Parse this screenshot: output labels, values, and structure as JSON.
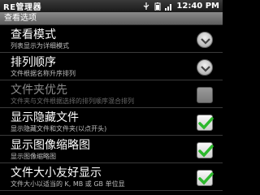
{
  "statusbar": {
    "app_name": "RE管理器",
    "time": "12:40 PM"
  },
  "header": {
    "title": "查看选项"
  },
  "items": [
    {
      "title": "查看模式",
      "summary": "列表显示为详细模式",
      "control": "chevron",
      "enabled": true
    },
    {
      "title": "排列顺序",
      "summary": "文件根据名称升序排列",
      "control": "chevron",
      "enabled": true
    },
    {
      "title": "文件夹优先",
      "summary": "文件夹与文件根据选择的排列顺序混合排列",
      "control": "checkbox",
      "checked": false,
      "enabled": false
    },
    {
      "title": "显示隐藏文件",
      "summary": "显示隐藏文件和文件夹(以点开头)",
      "control": "checkbox",
      "checked": true,
      "enabled": true
    },
    {
      "title": "显示图像缩略图",
      "summary": "显示图像缩略图",
      "control": "checkbox",
      "checked": true,
      "enabled": true
    },
    {
      "title": "文件大小友好显示",
      "summary": "文件大小以适当的 K, MB 或 GB 单位显",
      "control": "checkbox",
      "checked": true,
      "enabled": true
    }
  ],
  "colors": {
    "check_green": "#2db82d",
    "divider": "#3a3a3a"
  },
  "icons": [
    "usb-icon",
    "battery-icon",
    "signal-icon",
    "chevron-down-icon",
    "checkmark-icon"
  ]
}
